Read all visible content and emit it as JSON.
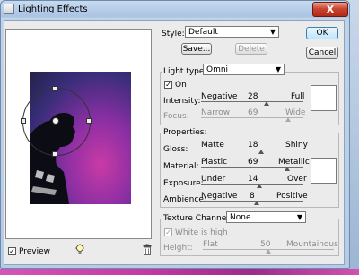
{
  "window": {
    "title": "Lighting Effects",
    "close_label": "X"
  },
  "style": {
    "label": "Style:",
    "value": "Default",
    "save_label": "Save...",
    "delete_label": "Delete"
  },
  "buttons": {
    "ok_label": "OK",
    "cancel_label": "Cancel"
  },
  "light": {
    "type_label": "Light type:",
    "type_value": "Omni",
    "on_label": "On",
    "on_checked": true,
    "intensity": {
      "label": "Intensity:",
      "left": "Negative",
      "value": "28",
      "right": "Full",
      "fraction": 0.64
    },
    "focus": {
      "label": "Focus:",
      "left": "Narrow",
      "value": "69",
      "right": "Wide",
      "fraction": 0.85
    }
  },
  "properties": {
    "label": "Properties:",
    "gloss": {
      "label": "Gloss:",
      "left": "Matte",
      "value": "18",
      "right": "Shiny",
      "fraction": 0.59
    },
    "material": {
      "label": "Material:",
      "left": "Plastic",
      "value": "69",
      "right": "Metallic",
      "fraction": 0.84
    },
    "exposure": {
      "label": "Exposure:",
      "left": "Under",
      "value": "14",
      "right": "Over",
      "fraction": 0.57
    },
    "ambience": {
      "label": "Ambience:",
      "left": "Negative",
      "value": "8",
      "right": "Positive",
      "fraction": 0.54
    }
  },
  "texture": {
    "channel_label": "Texture Channel:",
    "channel_value": "None",
    "white_is_high_label": "White is high",
    "white_is_high_checked": true,
    "height": {
      "label": "Height:",
      "left": "Flat",
      "value": "50",
      "right": "Mountainous",
      "fraction": 0.5
    }
  },
  "preview": {
    "label": "Preview",
    "checked": true
  },
  "icons": {
    "light_bulb": "light-bulb-icon",
    "trash": "trash-icon",
    "window": "window-icon"
  },
  "colors": {
    "ok_border": "#3c7fb1",
    "close_red": "#c8452f",
    "photo_magenta": "#c93aa6"
  }
}
